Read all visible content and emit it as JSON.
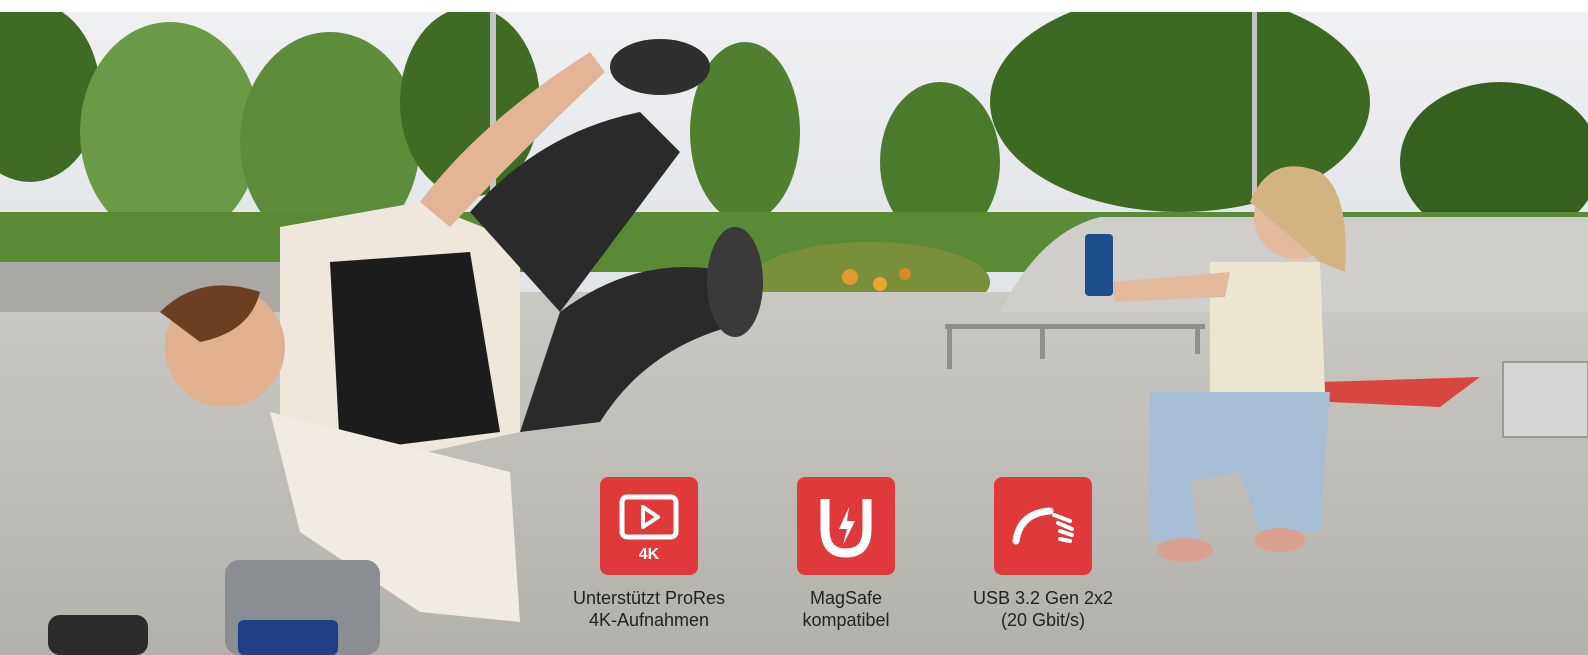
{
  "banner": {
    "features": [
      {
        "icon": "video-4k-icon",
        "badge": "4K",
        "line1": "Unterstützt ProRes",
        "line2": "4K-Aufnahmen"
      },
      {
        "icon": "magnet-icon",
        "line1": "MagSafe",
        "line2": "kompatibel"
      },
      {
        "icon": "speedometer-icon",
        "line1": "USB 3.2 Gen 2x2",
        "line2": "(20 Gbit/s)"
      }
    ],
    "colors": {
      "accent": "#e0393c",
      "sky": "#e9ebee",
      "ground": "#bdbcb7",
      "foliage": "#4c7a2c"
    }
  }
}
